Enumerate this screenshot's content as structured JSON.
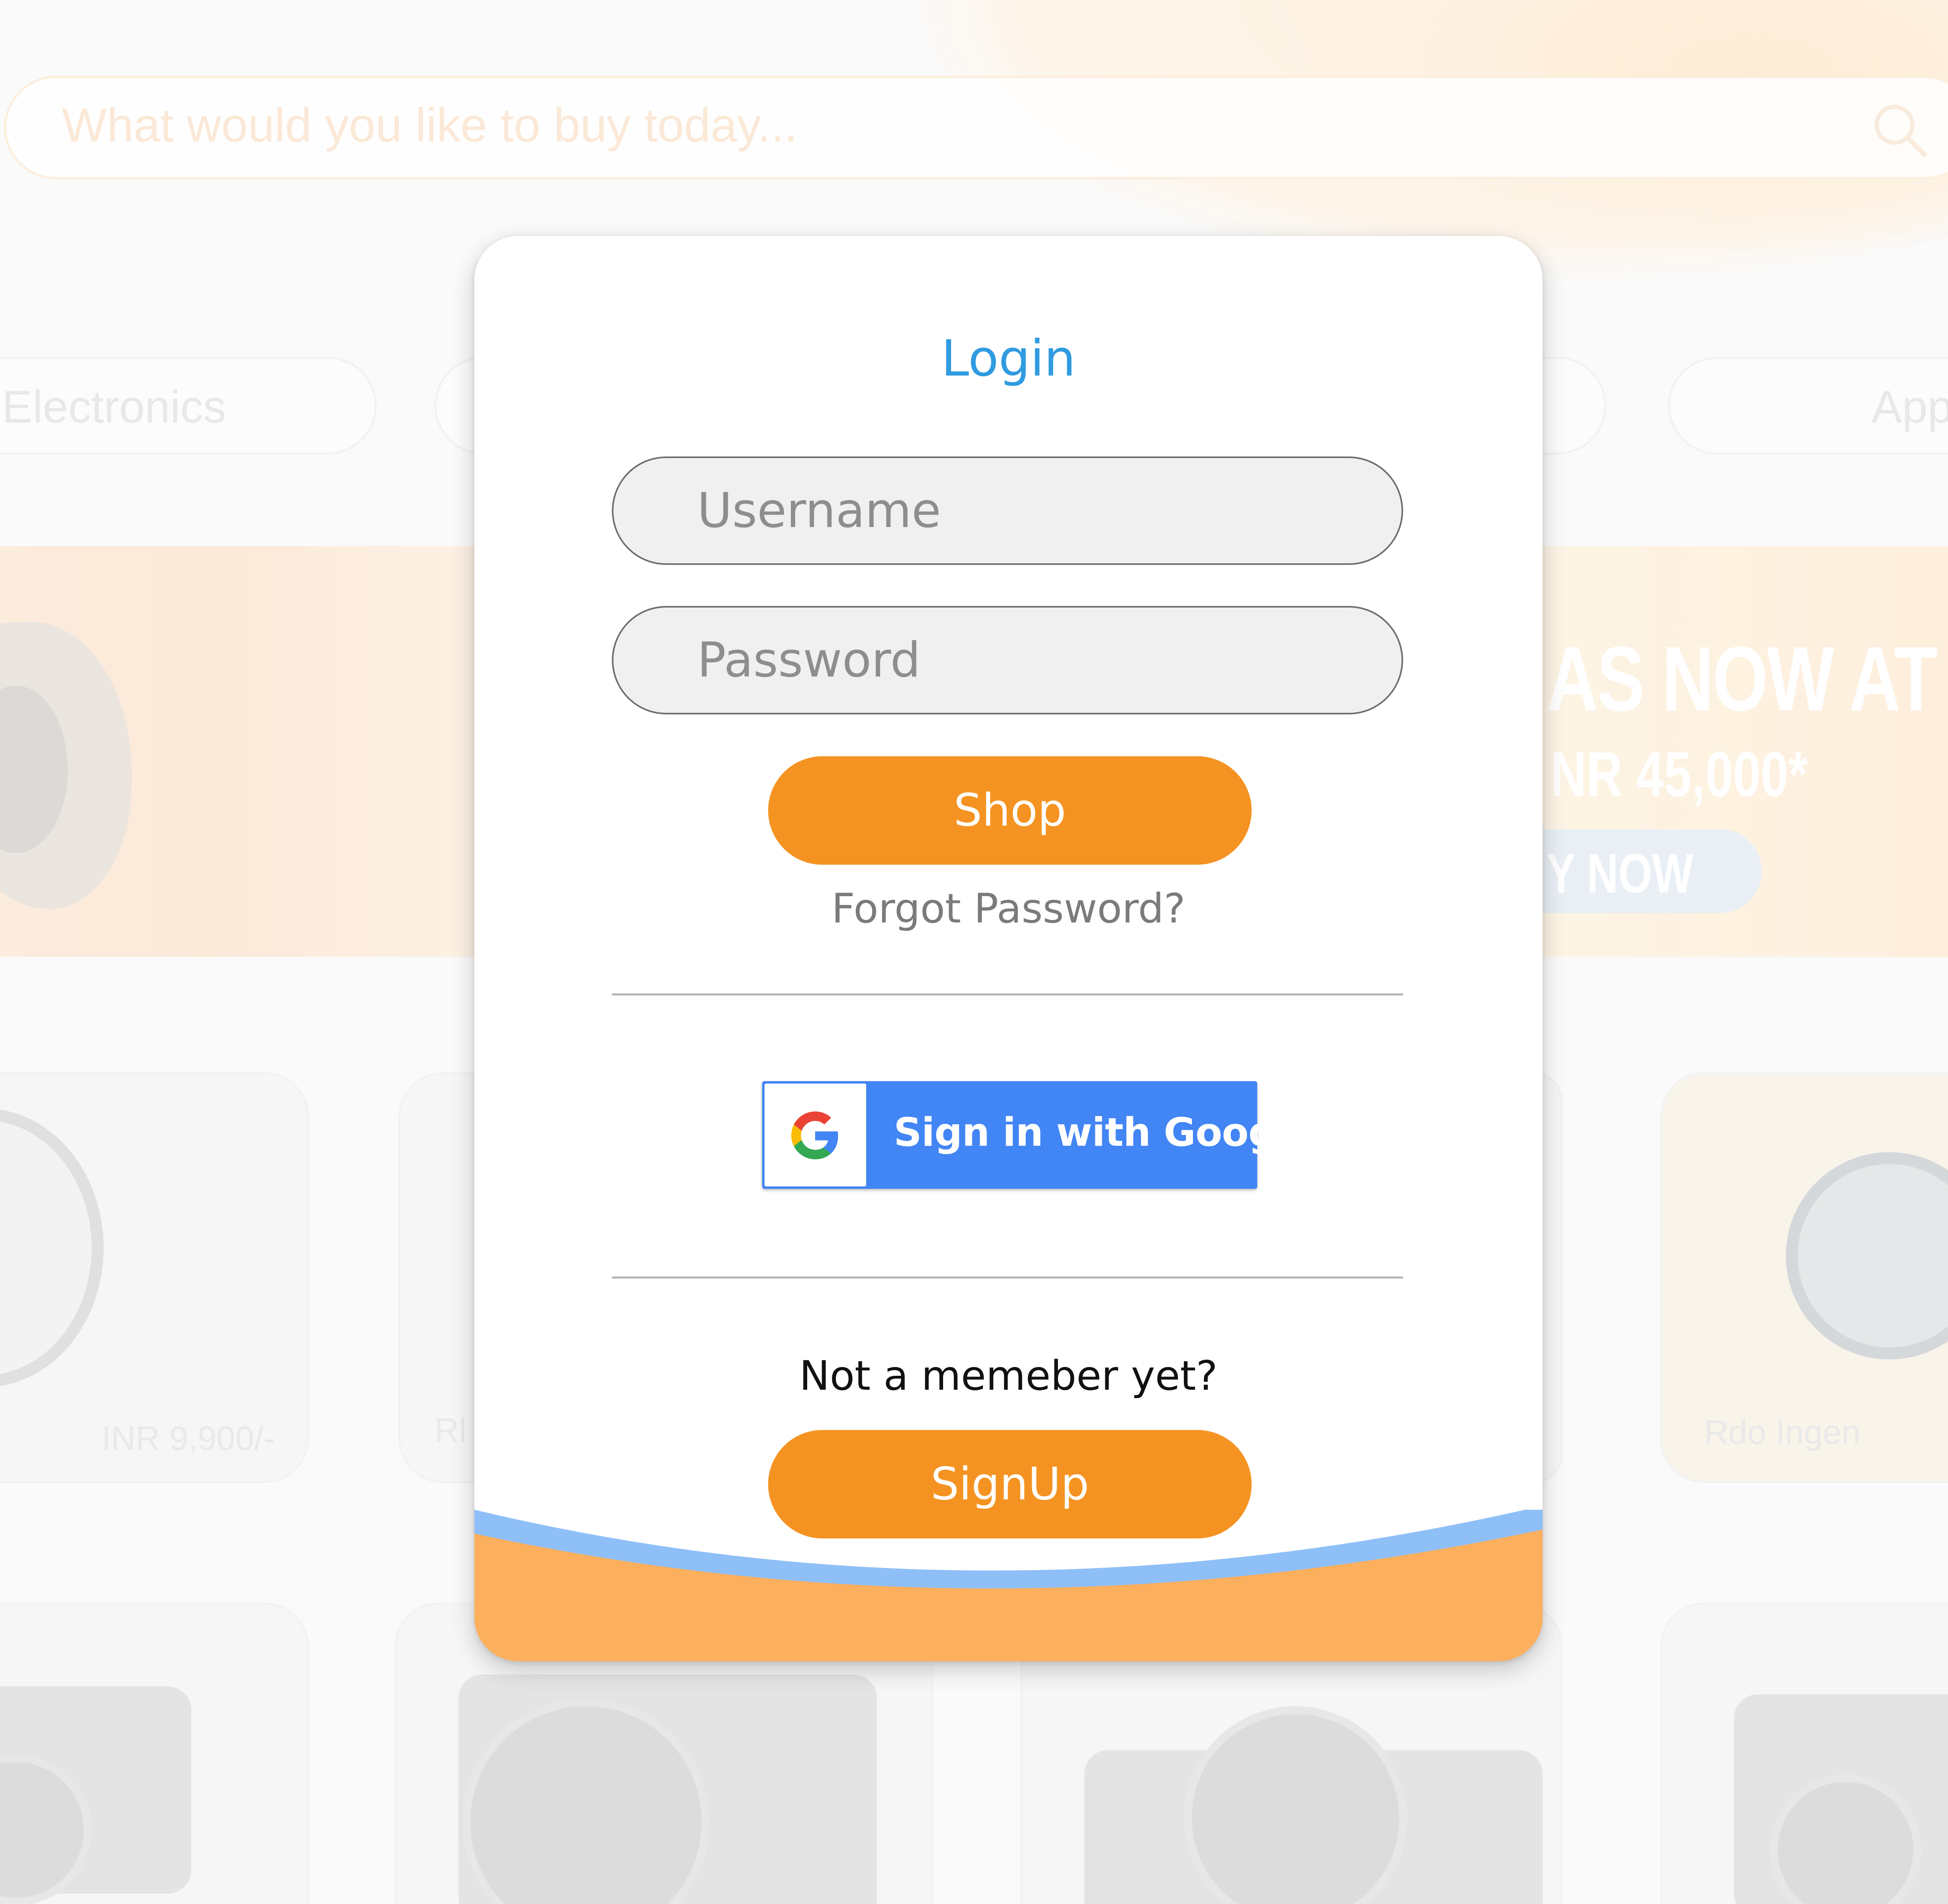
{
  "search": {
    "placeholder": "What would you like to buy today..."
  },
  "categories": [
    {
      "label": "Electronics"
    },
    {
      "label": "App"
    }
  ],
  "banner": {
    "headline": "AS NOW AT AI",
    "price": "NR 45,000*",
    "cta": "Y NOW"
  },
  "products": [
    {
      "price": "INR 9,900/-"
    },
    {
      "name": "Rl"
    },
    {
      "name": "Rdo Ingen"
    }
  ],
  "login": {
    "title": "Login",
    "username_placeholder": "Username",
    "password_placeholder": "Password",
    "submit_label": "Shop",
    "forgot_label": "Forgot Password?",
    "google_label": "Sign in with Google",
    "not_member_text": "Not a memeber yet?",
    "signup_label": "SignUp"
  },
  "colors": {
    "accent_orange": "#f59322",
    "title_blue": "#2f9be0",
    "google_blue": "#4285f4",
    "wave_blue": "#8fbff7",
    "wave_orange": "#fcaf5c"
  },
  "icons": {
    "search": "search-icon",
    "google": "google-g-icon"
  }
}
